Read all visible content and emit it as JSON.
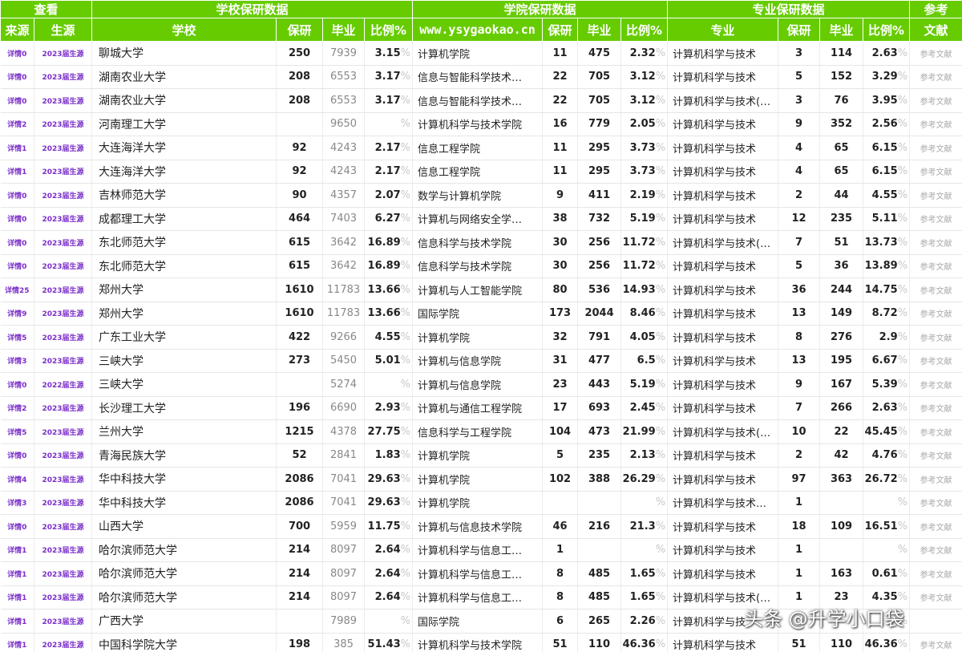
{
  "header": {
    "groups": [
      "查看",
      "学校保研数据",
      "学院保研数据",
      "专业保研数据",
      "参考"
    ],
    "cols": {
      "source": "来源",
      "year": "生源",
      "school": "学校",
      "baoyan": "保研",
      "grad": "毕业",
      "ratio": "比例%",
      "site": "www.ysygaokao.cn",
      "col_baoyan": "保研",
      "col_grad": "毕业",
      "col_ratio": "比例%",
      "major": "专业",
      "m_baoyan": "保研",
      "m_grad": "毕业",
      "m_ratio": "比例%",
      "ref": "文献"
    }
  },
  "pct_sign": "%",
  "rows": [
    {
      "src": "详情0",
      "yr": "2023届生源",
      "sch": "聊城大学",
      "sb": "250",
      "sg": "7939",
      "sr": "3.15",
      "col": "计算机学院",
      "cb": "11",
      "cg": "475",
      "cr": "2.32",
      "maj": "计算机科学与技术",
      "mb": "3",
      "mg": "114",
      "mr": "2.63",
      "ref": "参考文献"
    },
    {
      "src": "详情0",
      "yr": "2023届生源",
      "sch": "湖南农业大学",
      "sb": "208",
      "sg": "6553",
      "sr": "3.17",
      "col": "信息与智能科学技术…",
      "cb": "22",
      "cg": "705",
      "cr": "3.12",
      "maj": "计算机科学与技术",
      "mb": "5",
      "mg": "152",
      "mr": "3.29",
      "ref": "参考文献"
    },
    {
      "src": "详情0",
      "yr": "2023届生源",
      "sch": "湖南农业大学",
      "sb": "208",
      "sg": "6553",
      "sr": "3.17",
      "col": "信息与智能科学技术…",
      "cb": "22",
      "cg": "705",
      "cr": "3.12",
      "maj": "计算机科学与技术(…",
      "mb": "3",
      "mg": "76",
      "mr": "3.95",
      "ref": "参考文献"
    },
    {
      "src": "详情2",
      "yr": "2023届生源",
      "sch": "河南理工大学",
      "sb": "",
      "sg": "9650",
      "sr": "",
      "col": "计算机科学与技术学院",
      "cb": "16",
      "cg": "779",
      "cr": "2.05",
      "maj": "计算机科学与技术",
      "mb": "9",
      "mg": "352",
      "mr": "2.56",
      "ref": "参考文献"
    },
    {
      "src": "详情1",
      "yr": "2023届生源",
      "sch": "大连海洋大学",
      "sb": "92",
      "sg": "4243",
      "sr": "2.17",
      "col": "信息工程学院",
      "cb": "11",
      "cg": "295",
      "cr": "3.73",
      "maj": "计算机科学与技术",
      "mb": "4",
      "mg": "65",
      "mr": "6.15",
      "ref": "参考文献"
    },
    {
      "src": "详情1",
      "yr": "2023届生源",
      "sch": "大连海洋大学",
      "sb": "92",
      "sg": "4243",
      "sr": "2.17",
      "col": "信息工程学院",
      "cb": "11",
      "cg": "295",
      "cr": "3.73",
      "maj": "计算机科学与技术",
      "mb": "4",
      "mg": "65",
      "mr": "6.15",
      "ref": "参考文献"
    },
    {
      "src": "详情0",
      "yr": "2023届生源",
      "sch": "吉林师范大学",
      "sb": "90",
      "sg": "4357",
      "sr": "2.07",
      "col": "数学与计算机学院",
      "cb": "9",
      "cg": "411",
      "cr": "2.19",
      "maj": "计算机科学与技术",
      "mb": "2",
      "mg": "44",
      "mr": "4.55",
      "ref": "参考文献"
    },
    {
      "src": "详情0",
      "yr": "2023届生源",
      "sch": "成都理工大学",
      "sb": "464",
      "sg": "7403",
      "sr": "6.27",
      "col": "计算机与网络安全学…",
      "cb": "38",
      "cg": "732",
      "cr": "5.19",
      "maj": "计算机科学与技术",
      "mb": "12",
      "mg": "235",
      "mr": "5.11",
      "ref": "参考文献"
    },
    {
      "src": "详情0",
      "yr": "2023届生源",
      "sch": "东北师范大学",
      "sb": "615",
      "sg": "3642",
      "sr": "16.89",
      "col": "信息科学与技术学院",
      "cb": "30",
      "cg": "256",
      "cr": "11.72",
      "maj": "计算机科学与技术(…",
      "mb": "7",
      "mg": "51",
      "mr": "13.73",
      "ref": "参考文献"
    },
    {
      "src": "详情0",
      "yr": "2023届生源",
      "sch": "东北师范大学",
      "sb": "615",
      "sg": "3642",
      "sr": "16.89",
      "col": "信息科学与技术学院",
      "cb": "30",
      "cg": "256",
      "cr": "11.72",
      "maj": "计算机科学与技术",
      "mb": "5",
      "mg": "36",
      "mr": "13.89",
      "ref": "参考文献"
    },
    {
      "src": "详情25",
      "yr": "2023届生源",
      "sch": "郑州大学",
      "sb": "1610",
      "sg": "11783",
      "sr": "13.66",
      "col": "计算机与人工智能学院",
      "cb": "80",
      "cg": "536",
      "cr": "14.93",
      "maj": "计算机科学与技术",
      "mb": "36",
      "mg": "244",
      "mr": "14.75",
      "ref": "参考文献"
    },
    {
      "src": "详情9",
      "yr": "2023届生源",
      "sch": "郑州大学",
      "sb": "1610",
      "sg": "11783",
      "sr": "13.66",
      "col": "国际学院",
      "cb": "173",
      "cg": "2044",
      "cr": "8.46",
      "maj": "计算机科学与技术",
      "mb": "13",
      "mg": "149",
      "mr": "8.72",
      "ref": "参考文献"
    },
    {
      "src": "详情5",
      "yr": "2023届生源",
      "sch": "广东工业大学",
      "sb": "422",
      "sg": "9266",
      "sr": "4.55",
      "col": "计算机学院",
      "cb": "32",
      "cg": "791",
      "cr": "4.05",
      "maj": "计算机科学与技术",
      "mb": "8",
      "mg": "276",
      "mr": "2.9",
      "ref": "参考文献"
    },
    {
      "src": "详情3",
      "yr": "2023届生源",
      "sch": "三峡大学",
      "sb": "273",
      "sg": "5450",
      "sr": "5.01",
      "col": "计算机与信息学院",
      "cb": "31",
      "cg": "477",
      "cr": "6.5",
      "maj": "计算机科学与技术",
      "mb": "13",
      "mg": "195",
      "mr": "6.67",
      "ref": "参考文献"
    },
    {
      "src": "详情0",
      "yr": "2022届生源",
      "sch": "三峡大学",
      "sb": "",
      "sg": "5274",
      "sr": "",
      "col": "计算机与信息学院",
      "cb": "23",
      "cg": "443",
      "cr": "5.19",
      "maj": "计算机科学与技术",
      "mb": "9",
      "mg": "167",
      "mr": "5.39",
      "ref": "参考文献"
    },
    {
      "src": "详情2",
      "yr": "2023届生源",
      "sch": "长沙理工大学",
      "sb": "196",
      "sg": "6690",
      "sr": "2.93",
      "col": "计算机与通信工程学院",
      "cb": "17",
      "cg": "693",
      "cr": "2.45",
      "maj": "计算机科学与技术",
      "mb": "7",
      "mg": "266",
      "mr": "2.63",
      "ref": "参考文献"
    },
    {
      "src": "详情5",
      "yr": "2023届生源",
      "sch": "兰州大学",
      "sb": "1215",
      "sg": "4378",
      "sr": "27.75",
      "col": "信息科学与工程学院",
      "cb": "104",
      "cg": "473",
      "cr": "21.99",
      "maj": "计算机科学与技术(…",
      "mb": "10",
      "mg": "22",
      "mr": "45.45",
      "ref": "参考文献"
    },
    {
      "src": "详情0",
      "yr": "2023届生源",
      "sch": "青海民族大学",
      "sb": "52",
      "sg": "2841",
      "sr": "1.83",
      "col": "计算机学院",
      "cb": "5",
      "cg": "235",
      "cr": "2.13",
      "maj": "计算机科学与技术",
      "mb": "2",
      "mg": "42",
      "mr": "4.76",
      "ref": "参考文献"
    },
    {
      "src": "详情4",
      "yr": "2023届生源",
      "sch": "华中科技大学",
      "sb": "2086",
      "sg": "7041",
      "sr": "29.63",
      "col": "计算机学院",
      "cb": "102",
      "cg": "388",
      "cr": "26.29",
      "maj": "计算机科学与技术",
      "mb": "97",
      "mg": "363",
      "mr": "26.72",
      "ref": "参考文献"
    },
    {
      "src": "详情3",
      "yr": "2023届生源",
      "sch": "华中科技大学",
      "sb": "2086",
      "sg": "7041",
      "sr": "29.63",
      "col": "计算机学院",
      "cb": "",
      "cg": "",
      "cr": "",
      "maj": "计算机科学与技术…",
      "mb": "1",
      "mg": "",
      "mr": "",
      "ref": "参考文献"
    },
    {
      "src": "详情0",
      "yr": "2023届生源",
      "sch": "山西大学",
      "sb": "700",
      "sg": "5959",
      "sr": "11.75",
      "col": "计算机与信息技术学院",
      "cb": "46",
      "cg": "216",
      "cr": "21.3",
      "maj": "计算机科学与技术",
      "mb": "18",
      "mg": "109",
      "mr": "16.51",
      "ref": "参考文献"
    },
    {
      "src": "详情1",
      "yr": "2023届生源",
      "sch": "哈尔滨师范大学",
      "sb": "214",
      "sg": "8097",
      "sr": "2.64",
      "col": "计算机科学与信息工…",
      "cb": "1",
      "cg": "",
      "cr": "",
      "maj": "计算机科学与技术",
      "mb": "1",
      "mg": "",
      "mr": "",
      "ref": "参考文献"
    },
    {
      "src": "详情1",
      "yr": "2023届生源",
      "sch": "哈尔滨师范大学",
      "sb": "214",
      "sg": "8097",
      "sr": "2.64",
      "col": "计算机科学与信息工…",
      "cb": "8",
      "cg": "485",
      "cr": "1.65",
      "maj": "计算机科学与技术",
      "mb": "1",
      "mg": "163",
      "mr": "0.61",
      "ref": "参考文献"
    },
    {
      "src": "详情1",
      "yr": "2023届生源",
      "sch": "哈尔滨师范大学",
      "sb": "214",
      "sg": "8097",
      "sr": "2.64",
      "col": "计算机科学与信息工…",
      "cb": "8",
      "cg": "485",
      "cr": "1.65",
      "maj": "计算机科学与技术(…",
      "mb": "1",
      "mg": "23",
      "mr": "4.35",
      "ref": "参考文献"
    },
    {
      "src": "详情1",
      "yr": "2023届生源",
      "sch": "广西大学",
      "sb": "",
      "sg": "7989",
      "sr": "",
      "col": "国际学院",
      "cb": "6",
      "cg": "265",
      "cr": "2.26",
      "maj": "计算机科学与技",
      "mb": "",
      "mg": "",
      "mr": "",
      "ref": ""
    },
    {
      "src": "详情1",
      "yr": "2023届生源",
      "sch": "中国科学院大学",
      "sb": "198",
      "sg": "385",
      "sr": "51.43",
      "col": "计算机科学与技术学院",
      "cb": "51",
      "cg": "110",
      "cr": "46.36",
      "maj": "计算机科学与技术",
      "mb": "51",
      "mg": "110",
      "mr": "46.36",
      "ref": "参考文献"
    }
  ],
  "watermark": "头条 @升学小口袋"
}
